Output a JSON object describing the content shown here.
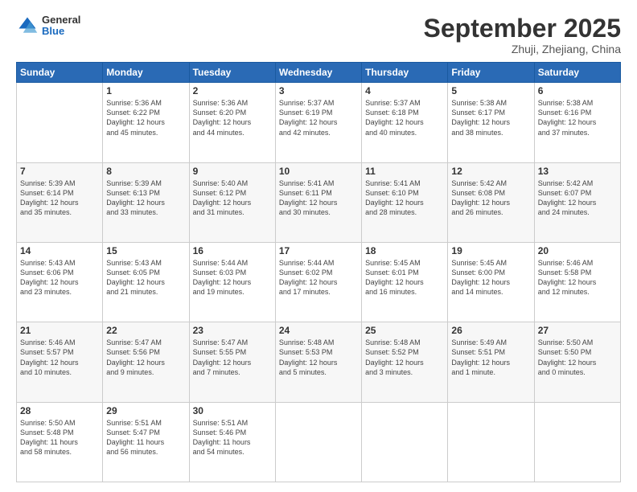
{
  "header": {
    "logo": {
      "general": "General",
      "blue": "Blue"
    },
    "title": "September 2025",
    "location": "Zhuji, Zhejiang, China"
  },
  "weekdays": [
    "Sunday",
    "Monday",
    "Tuesday",
    "Wednesday",
    "Thursday",
    "Friday",
    "Saturday"
  ],
  "weeks": [
    [
      {
        "day": "",
        "info": ""
      },
      {
        "day": "1",
        "info": "Sunrise: 5:36 AM\nSunset: 6:22 PM\nDaylight: 12 hours\nand 45 minutes."
      },
      {
        "day": "2",
        "info": "Sunrise: 5:36 AM\nSunset: 6:20 PM\nDaylight: 12 hours\nand 44 minutes."
      },
      {
        "day": "3",
        "info": "Sunrise: 5:37 AM\nSunset: 6:19 PM\nDaylight: 12 hours\nand 42 minutes."
      },
      {
        "day": "4",
        "info": "Sunrise: 5:37 AM\nSunset: 6:18 PM\nDaylight: 12 hours\nand 40 minutes."
      },
      {
        "day": "5",
        "info": "Sunrise: 5:38 AM\nSunset: 6:17 PM\nDaylight: 12 hours\nand 38 minutes."
      },
      {
        "day": "6",
        "info": "Sunrise: 5:38 AM\nSunset: 6:16 PM\nDaylight: 12 hours\nand 37 minutes."
      }
    ],
    [
      {
        "day": "7",
        "info": "Sunrise: 5:39 AM\nSunset: 6:14 PM\nDaylight: 12 hours\nand 35 minutes."
      },
      {
        "day": "8",
        "info": "Sunrise: 5:39 AM\nSunset: 6:13 PM\nDaylight: 12 hours\nand 33 minutes."
      },
      {
        "day": "9",
        "info": "Sunrise: 5:40 AM\nSunset: 6:12 PM\nDaylight: 12 hours\nand 31 minutes."
      },
      {
        "day": "10",
        "info": "Sunrise: 5:41 AM\nSunset: 6:11 PM\nDaylight: 12 hours\nand 30 minutes."
      },
      {
        "day": "11",
        "info": "Sunrise: 5:41 AM\nSunset: 6:10 PM\nDaylight: 12 hours\nand 28 minutes."
      },
      {
        "day": "12",
        "info": "Sunrise: 5:42 AM\nSunset: 6:08 PM\nDaylight: 12 hours\nand 26 minutes."
      },
      {
        "day": "13",
        "info": "Sunrise: 5:42 AM\nSunset: 6:07 PM\nDaylight: 12 hours\nand 24 minutes."
      }
    ],
    [
      {
        "day": "14",
        "info": "Sunrise: 5:43 AM\nSunset: 6:06 PM\nDaylight: 12 hours\nand 23 minutes."
      },
      {
        "day": "15",
        "info": "Sunrise: 5:43 AM\nSunset: 6:05 PM\nDaylight: 12 hours\nand 21 minutes."
      },
      {
        "day": "16",
        "info": "Sunrise: 5:44 AM\nSunset: 6:03 PM\nDaylight: 12 hours\nand 19 minutes."
      },
      {
        "day": "17",
        "info": "Sunrise: 5:44 AM\nSunset: 6:02 PM\nDaylight: 12 hours\nand 17 minutes."
      },
      {
        "day": "18",
        "info": "Sunrise: 5:45 AM\nSunset: 6:01 PM\nDaylight: 12 hours\nand 16 minutes."
      },
      {
        "day": "19",
        "info": "Sunrise: 5:45 AM\nSunset: 6:00 PM\nDaylight: 12 hours\nand 14 minutes."
      },
      {
        "day": "20",
        "info": "Sunrise: 5:46 AM\nSunset: 5:58 PM\nDaylight: 12 hours\nand 12 minutes."
      }
    ],
    [
      {
        "day": "21",
        "info": "Sunrise: 5:46 AM\nSunset: 5:57 PM\nDaylight: 12 hours\nand 10 minutes."
      },
      {
        "day": "22",
        "info": "Sunrise: 5:47 AM\nSunset: 5:56 PM\nDaylight: 12 hours\nand 9 minutes."
      },
      {
        "day": "23",
        "info": "Sunrise: 5:47 AM\nSunset: 5:55 PM\nDaylight: 12 hours\nand 7 minutes."
      },
      {
        "day": "24",
        "info": "Sunrise: 5:48 AM\nSunset: 5:53 PM\nDaylight: 12 hours\nand 5 minutes."
      },
      {
        "day": "25",
        "info": "Sunrise: 5:48 AM\nSunset: 5:52 PM\nDaylight: 12 hours\nand 3 minutes."
      },
      {
        "day": "26",
        "info": "Sunrise: 5:49 AM\nSunset: 5:51 PM\nDaylight: 12 hours\nand 1 minute."
      },
      {
        "day": "27",
        "info": "Sunrise: 5:50 AM\nSunset: 5:50 PM\nDaylight: 12 hours\nand 0 minutes."
      }
    ],
    [
      {
        "day": "28",
        "info": "Sunrise: 5:50 AM\nSunset: 5:48 PM\nDaylight: 11 hours\nand 58 minutes."
      },
      {
        "day": "29",
        "info": "Sunrise: 5:51 AM\nSunset: 5:47 PM\nDaylight: 11 hours\nand 56 minutes."
      },
      {
        "day": "30",
        "info": "Sunrise: 5:51 AM\nSunset: 5:46 PM\nDaylight: 11 hours\nand 54 minutes."
      },
      {
        "day": "",
        "info": ""
      },
      {
        "day": "",
        "info": ""
      },
      {
        "day": "",
        "info": ""
      },
      {
        "day": "",
        "info": ""
      }
    ]
  ]
}
